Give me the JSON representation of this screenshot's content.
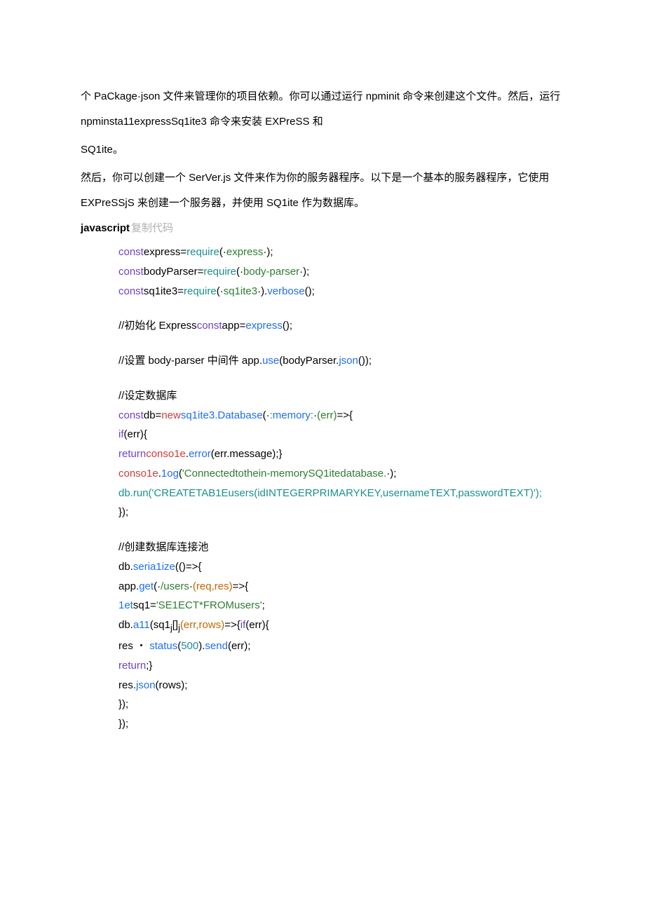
{
  "paragraph1": {
    "t1": "个 PaCkage",
    "t2": "json 文件来管理你的项目依赖。你可以通过运行 npminit 命令来创建这个文件。然后，运行 npminsta11expressSq1ite3 命令来安装 EXPreSS 和",
    "t3": "SQ1ite。"
  },
  "paragraph2": "然后，你可以创建一个 SerVer.js 文件来作为你的服务器程序。以下是一个基本的服务器程序，它使用 EXPreSSjS 来创建一个服务器，并使用 SQ1ite 作为数据库。",
  "jsheader": {
    "label": "javascript",
    "copy": "复制代码"
  },
  "code": {
    "l1": {
      "const": "const",
      "name": "express=",
      "req": "require",
      "paren1": "(",
      "str": "express",
      "paren2": ");"
    },
    "l2": {
      "const": "const",
      "name": "bodyParser=",
      "req": "require",
      "paren1": "(",
      "str": "body-parser",
      "paren2": ");"
    },
    "l3": {
      "const": "const",
      "name": "sq1ite3=",
      "req": "require",
      "paren1": "(",
      "str": "sq1ite3",
      "mid": ").",
      "verb": "verbose",
      "end": "();"
    },
    "l4": {
      "cmt": "//初始化 Express",
      "const": "const",
      "name": "app=",
      "fn": "express",
      "end": "();"
    },
    "l5": {
      "cmt": "//设置 body-parser 中间件 app.",
      "use": "use",
      "mid": "(bodyParser.",
      "json": "json",
      "end": "());"
    },
    "l6": "//设定数据库",
    "l7": {
      "const": "const",
      "name": "db=",
      "new": "new",
      "cls": "sq1ite3.Database",
      "p1": "(",
      "str": ":memory:",
      "p2": "(",
      "err": "err",
      "p3": ")",
      "arrow": "=>{"
    },
    "l8": {
      "if": "if",
      "rest": "(err){"
    },
    "l9": {
      "ret": "return",
      "cons": "conso1e",
      "dot": ".",
      "err": "error",
      "rest": "(err.message);}"
    },
    "l10": {
      "cons": "conso1e",
      "dot": ".",
      "log": "1og",
      "p1": "(",
      "str": "'Connectedtothein-memorySQ1itedatabase.",
      "p2": ");"
    },
    "l11": {
      "db": "db.",
      "run": "run",
      "p1": "(",
      "str": "'CREATETAB1Eusers(idINTEGERPRIMARYKEY,usernameTEXT,passwordTEXT)'",
      "p2": ");"
    },
    "l12": "});",
    "l13": "//创建数据库连接池",
    "l14": {
      "pre": "db.",
      "fn": "seria1ize",
      "rest": "(()=>{"
    },
    "l15": {
      "pre": "app.",
      "fn": "get",
      "p1": "(",
      "str": "/users",
      "p2c": "(req,res)",
      "arrow": "=>{"
    },
    "l16": {
      "let": "1et",
      "name": "sq1=",
      "str": "'SE1ECT*FROMusers'",
      "end": ";"
    },
    "l17": {
      "pre": "db.",
      "fn": "a11",
      "p1": "(sq1",
      "sub": "j",
      "br": "[]",
      "sub2": "j",
      "args": "(err,rows)",
      "arrow": "=>{",
      "if": "if",
      "rest": "(err){"
    },
    "l18": {
      "pre": "res ・ ",
      "stat": "status",
      "p1": "(",
      "num": "500",
      "p2": ").",
      "send": "send",
      "p3": "(err);"
    },
    "l19": {
      "ret": "return",
      "rest": ";}"
    },
    "l20": {
      "pre": "res.",
      "fn": "json",
      "rest": "(rows);"
    },
    "l21": "});",
    "l22": "});"
  }
}
